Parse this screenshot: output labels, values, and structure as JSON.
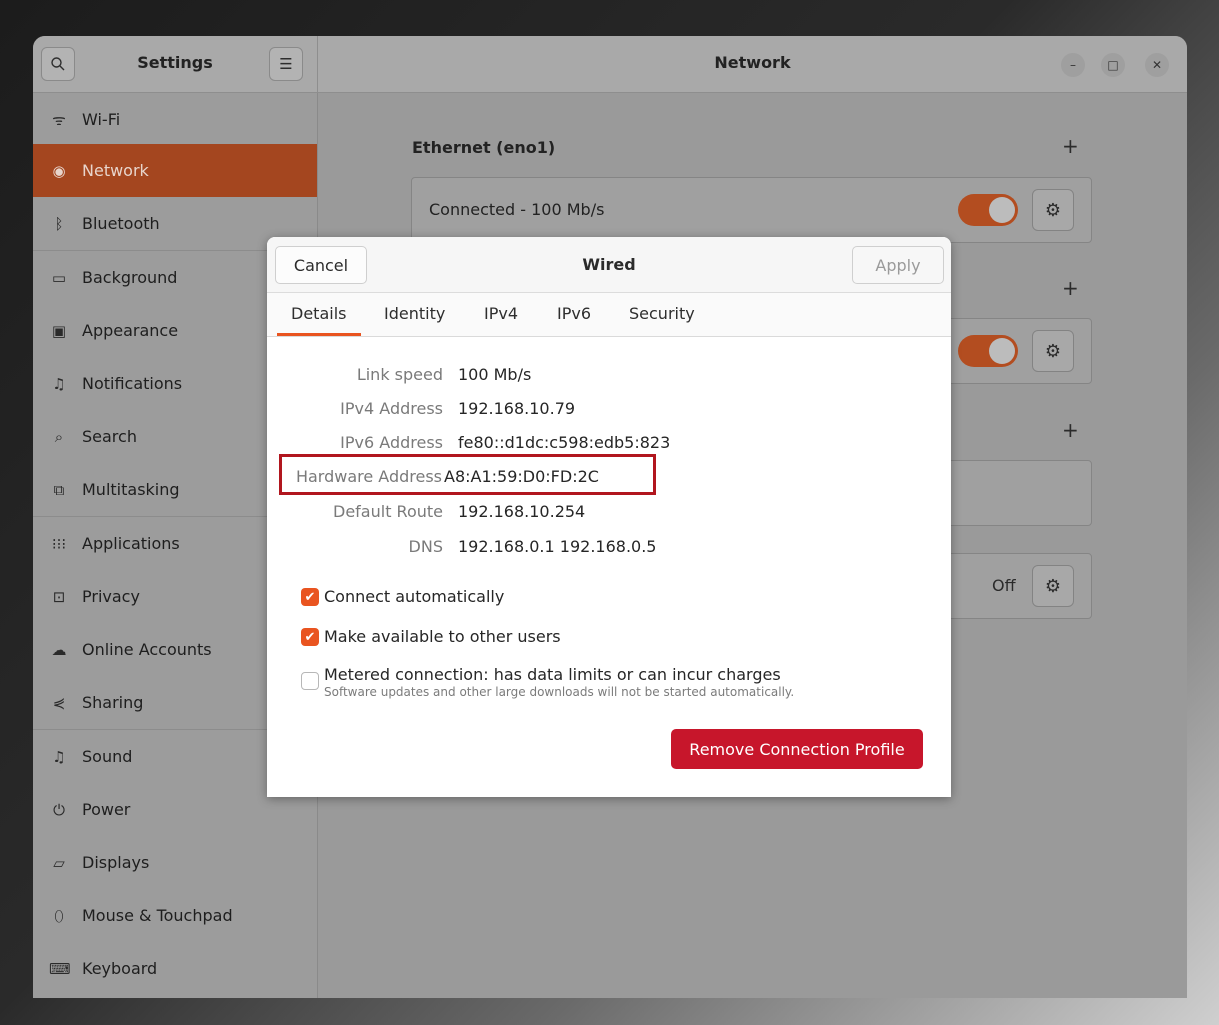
{
  "sidebar": {
    "title": "Settings",
    "items": [
      {
        "label": "Wi-Fi",
        "icon": "wifi-icon"
      },
      {
        "label": "Network",
        "icon": "globe-icon"
      },
      {
        "label": "Bluetooth",
        "icon": "bluetooth-icon"
      },
      {
        "label": "Background",
        "icon": "background-icon"
      },
      {
        "label": "Appearance",
        "icon": "appearance-icon"
      },
      {
        "label": "Notifications",
        "icon": "bell-icon"
      },
      {
        "label": "Search",
        "icon": "search-icon"
      },
      {
        "label": "Multitasking",
        "icon": "multitasking-icon"
      },
      {
        "label": "Applications",
        "icon": "apps-grid-icon"
      },
      {
        "label": "Privacy",
        "icon": "lock-icon"
      },
      {
        "label": "Online Accounts",
        "icon": "cloud-icon"
      },
      {
        "label": "Sharing",
        "icon": "share-icon"
      },
      {
        "label": "Sound",
        "icon": "music-note-icon"
      },
      {
        "label": "Power",
        "icon": "power-icon"
      },
      {
        "label": "Displays",
        "icon": "display-icon"
      },
      {
        "label": "Mouse & Touchpad",
        "icon": "mouse-icon"
      },
      {
        "label": "Keyboard",
        "icon": "keyboard-icon"
      }
    ],
    "active_index": 1
  },
  "header": {
    "title": "Network"
  },
  "ethernet": {
    "title": "Ethernet (eno1)",
    "status": "Connected - 100 Mb/s",
    "toggle_on": true
  },
  "vpn_card": {
    "toggle_on": true
  },
  "proxy_card": {
    "status": "Off"
  },
  "dialog": {
    "title": "Wired",
    "cancel_label": "Cancel",
    "apply_label": "Apply",
    "tabs": [
      "Details",
      "Identity",
      "IPv4",
      "IPv6",
      "Security"
    ],
    "active_tab": "Details",
    "details": [
      {
        "label": "Link speed",
        "value": "100 Mb/s"
      },
      {
        "label": "IPv4 Address",
        "value": "192.168.10.79"
      },
      {
        "label": "IPv6 Address",
        "value": "fe80::d1dc:c598:edb5:823"
      },
      {
        "label": "Hardware Address",
        "value": "A8:A1:59:D0:FD:2C"
      },
      {
        "label": "Default Route",
        "value": "192.168.10.254"
      },
      {
        "label": "DNS",
        "value": "192.168.0.1 192.168.0.5"
      }
    ],
    "checkboxes": [
      {
        "label": "Connect automatically",
        "checked": true
      },
      {
        "label": "Make available to other users",
        "checked": true
      },
      {
        "label": "Metered connection: has data limits or can incur charges",
        "checked": false,
        "sublabel": "Software updates and other large downloads will not be started automatically."
      }
    ],
    "remove_label": "Remove Connection Profile"
  },
  "colors": {
    "accent": "#e95420",
    "destructive": "#c7162b",
    "highlight": "#b1161e",
    "active_sidebar": "#a4461f"
  }
}
